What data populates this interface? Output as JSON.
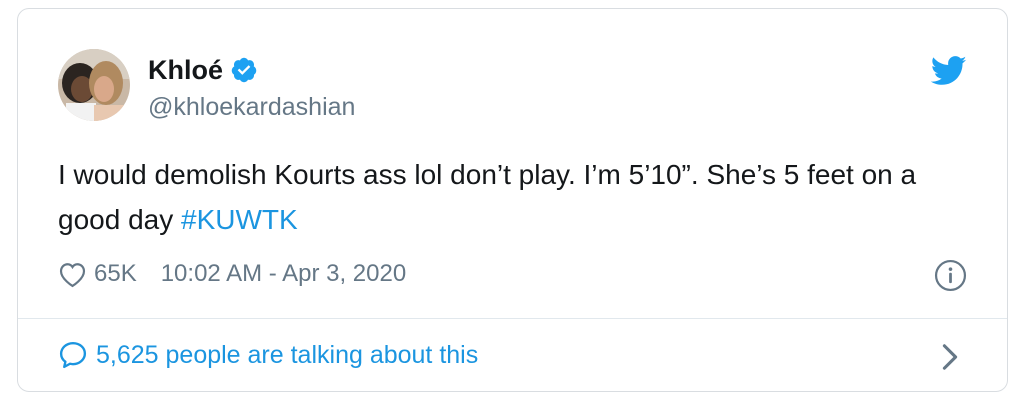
{
  "tweet": {
    "author": {
      "display_name": "Khloé",
      "handle": "@khloekardashian",
      "verified": true
    },
    "text_plain": "I would demolish Kourts ass lol don’t play. I’m 5’10”. She’s 5 feet on a good day ",
    "hashtag": "#KUWTK",
    "likes": "65K",
    "timestamp": "10:02 AM - Apr 3, 2020",
    "talking": "5,625 people are talking about this"
  },
  "icons": {
    "brand": "twitter-bird-icon",
    "verified": "verified-badge-icon",
    "like": "heart-icon",
    "info": "info-icon",
    "conversation": "speech-bubble-icon",
    "navigate": "chevron-right-icon"
  },
  "colors": {
    "twitter_blue": "#1da1f2",
    "link_blue": "#1b95e0",
    "text_primary": "#14171a",
    "text_secondary": "#657786",
    "border": "#d9dde1"
  }
}
